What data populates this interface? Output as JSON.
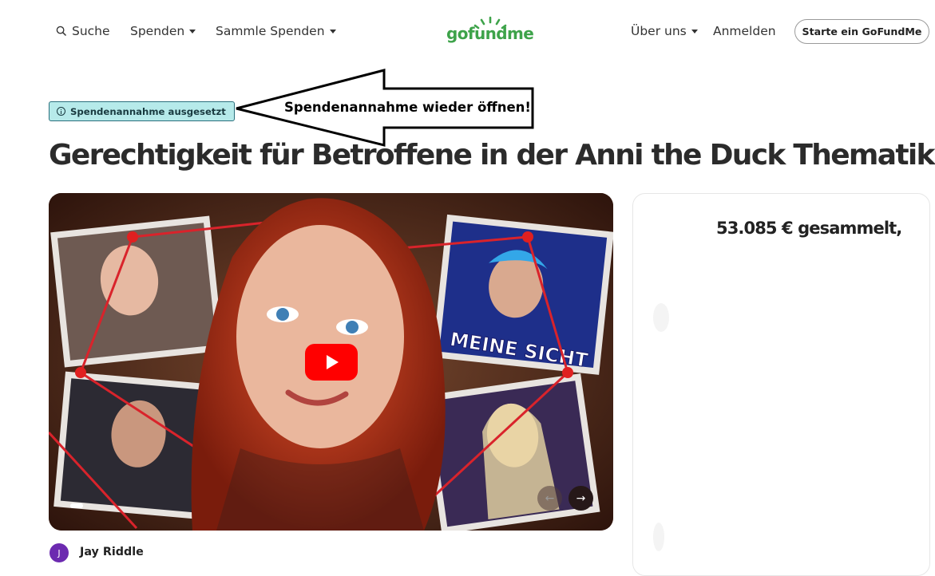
{
  "nav": {
    "search": "Suche",
    "donate": "Spenden",
    "fundraise": "Sammle Spenden",
    "about": "Über uns",
    "login": "Anmelden",
    "cta": "Starte ein GoFundMe"
  },
  "logo": {
    "text": "gofundme",
    "color": "#3ea34a"
  },
  "badge": {
    "text": "Spendenannahme ausgesetzt",
    "icon": "info-icon"
  },
  "annotation": {
    "text": "Spendenannahme wieder öffnen!"
  },
  "campaign": {
    "title": "Gerechtigkeit für Betroffene in der Anni the Duck Thematik",
    "video_text": "MEINE SICHT",
    "organizer_initial": "J",
    "organizer_name": "Jay Riddle"
  },
  "sidebar": {
    "raised": "53.085 € gesammelt,"
  },
  "colors": {
    "accent": "#3ea34a",
    "badge_bg": "#b6eaea",
    "badge_border": "#2a6f7c",
    "avatar": "#6c2ab0",
    "play": "#ff0000"
  }
}
